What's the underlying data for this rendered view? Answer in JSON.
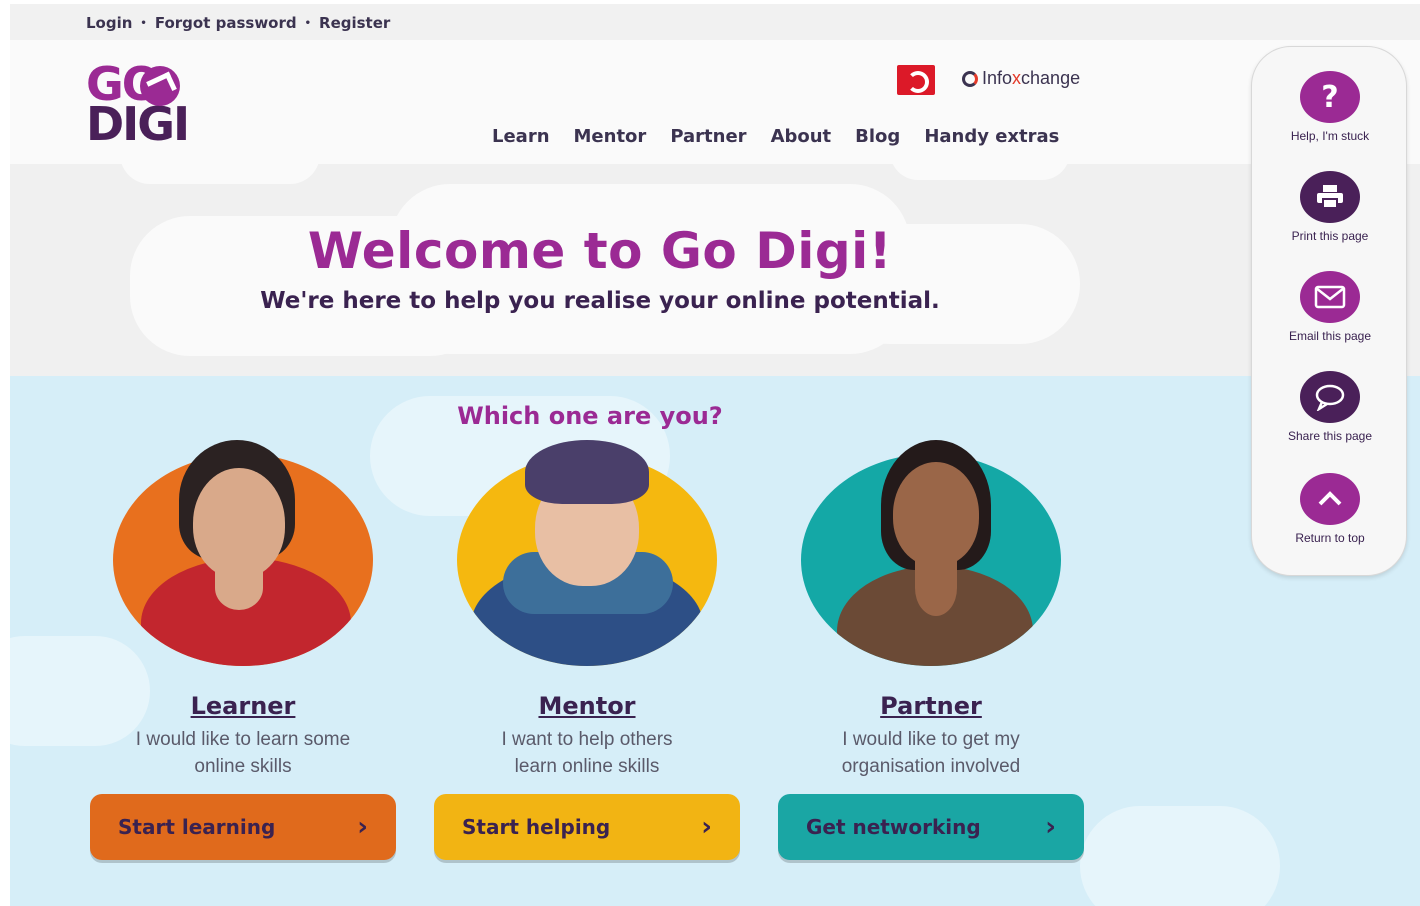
{
  "utility": {
    "links": [
      "Login",
      "Forgot password",
      "Register"
    ],
    "separator": "•"
  },
  "logo": {
    "line1": "GO",
    "line2": "DIGI"
  },
  "sponsors": {
    "infoxchange": {
      "pre": "Info",
      "x": "x",
      "post": "change"
    }
  },
  "nav": {
    "items": [
      "Learn",
      "Mentor",
      "Partner",
      "About",
      "Blog",
      "Handy extras"
    ]
  },
  "hero": {
    "title": "Welcome to Go Digi!",
    "subtitle": "We're here to help you realise your online potential."
  },
  "personas": {
    "heading": "Which one are you?",
    "items": [
      {
        "name": "Learner",
        "desc_line1": "I would like to learn some",
        "desc_line2": "online skills",
        "button": "Start learning",
        "color": "#e06a1c",
        "photo_bg": "#e8701e"
      },
      {
        "name": "Mentor",
        "desc_line1": "I want to help others",
        "desc_line2": "learn online skills",
        "button": "Start helping",
        "color": "#f2b413",
        "photo_bg": "#f5b80f"
      },
      {
        "name": "Partner",
        "desc_line1": "I would like to get my",
        "desc_line2": "organisation involved",
        "button": "Get networking",
        "color": "#1aa6a4",
        "photo_bg": "#14a8a6"
      }
    ],
    "chevron": "›"
  },
  "tools": {
    "items": [
      {
        "label": "Help, I'm stuck",
        "icon": "question-icon",
        "glyph": "?",
        "color": "#9b2a94"
      },
      {
        "label": "Print this page",
        "icon": "printer-icon",
        "glyph": "",
        "color": "#4a2059"
      },
      {
        "label": "Email this page",
        "icon": "envelope-icon",
        "glyph": "",
        "color": "#9b2a94"
      },
      {
        "label": "Share this page",
        "icon": "speech-bubble-icon",
        "glyph": "",
        "color": "#4a2059"
      },
      {
        "label": "Return to top",
        "icon": "chevron-up-icon",
        "glyph": "",
        "color": "#9b2a94"
      }
    ]
  },
  "colors": {
    "brand_purple": "#9b2a94",
    "brand_dark": "#4a2059",
    "sky": "#d6eef8"
  }
}
